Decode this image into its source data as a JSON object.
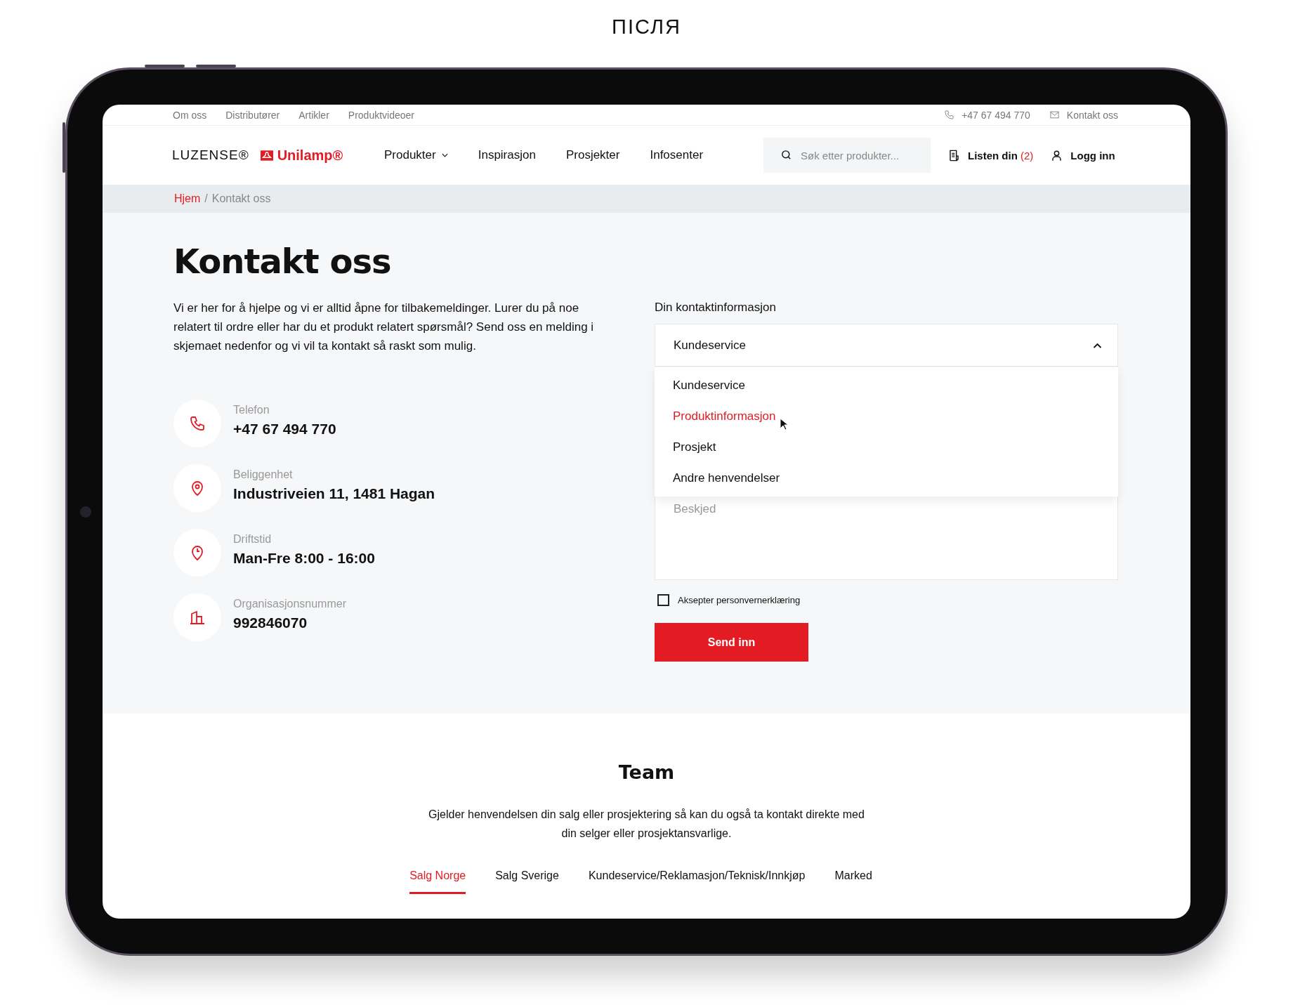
{
  "caption": "ПІСЛЯ",
  "top_bar": {
    "links": [
      "Om oss",
      "Distributører",
      "Artikler",
      "Produktvideoer"
    ],
    "phone": "+47 67 494 770",
    "contact": "Kontakt oss"
  },
  "header": {
    "brand_primary": "LUZENSE®",
    "brand_secondary": "Unilamp®",
    "nav": [
      {
        "label": "Produkter",
        "has_menu": true
      },
      {
        "label": "Inspirasjon",
        "has_menu": false
      },
      {
        "label": "Prosjekter",
        "has_menu": false
      },
      {
        "label": "Infosenter",
        "has_menu": false
      }
    ],
    "search": {
      "placeholder": "Søk etter produkter..."
    },
    "list": {
      "label": "Listen din",
      "count": "(2)"
    },
    "login": "Logg inn"
  },
  "breadcrumb": {
    "separator": "/",
    "items": [
      "Hjem",
      "Kontakt oss"
    ]
  },
  "title": "Kontakt oss",
  "intro": "Vi er her for å hjelpe og vi er alltid åpne for tilbakemeldinger. Lurer du på noe relatert til ordre eller har du et produkt relatert spørsmål? Send oss en melding i skjemaet nedenfor og vi vil ta kontakt så raskt som mulig.",
  "contacts": [
    {
      "kind": "phone",
      "label": "Telefon",
      "value": "+47 67 494 770"
    },
    {
      "kind": "location",
      "label": "Beliggenhet",
      "value": "Industriveien 11, 1481 Hagan"
    },
    {
      "kind": "hours",
      "label": "Driftstid",
      "value": "Man-Fre 8:00 - 16:00"
    },
    {
      "kind": "org",
      "label": "Organisasjonsnummer",
      "value": "992846070"
    }
  ],
  "form": {
    "label": "Din kontaktinformasjon",
    "select": {
      "value": "Kundeservice",
      "expanded": true,
      "options": [
        {
          "label": "Kundeservice",
          "highlighted": false
        },
        {
          "label": "Produktinformasjon",
          "highlighted": true
        },
        {
          "label": "Prosjekt",
          "highlighted": false
        },
        {
          "label": "Andre henvendelser",
          "highlighted": false
        }
      ]
    },
    "message": {
      "placeholder": "Beskjed"
    },
    "consent": {
      "label": "Aksepter personvernerklæring",
      "checked": false
    },
    "submit": "Send inn"
  },
  "team": {
    "title": "Team",
    "text": "Gjelder henvendelsen din salg eller prosjektering så kan du også ta kontakt direkte med din selger eller prosjektansvarlige.",
    "tabs": [
      {
        "label": "Salg Norge",
        "selected": true
      },
      {
        "label": "Salg Sverige",
        "selected": false
      },
      {
        "label": "Kundeservice/Reklamasjon/Teknisk/Innkjøp",
        "selected": false
      },
      {
        "label": "Marked",
        "selected": false
      }
    ]
  }
}
